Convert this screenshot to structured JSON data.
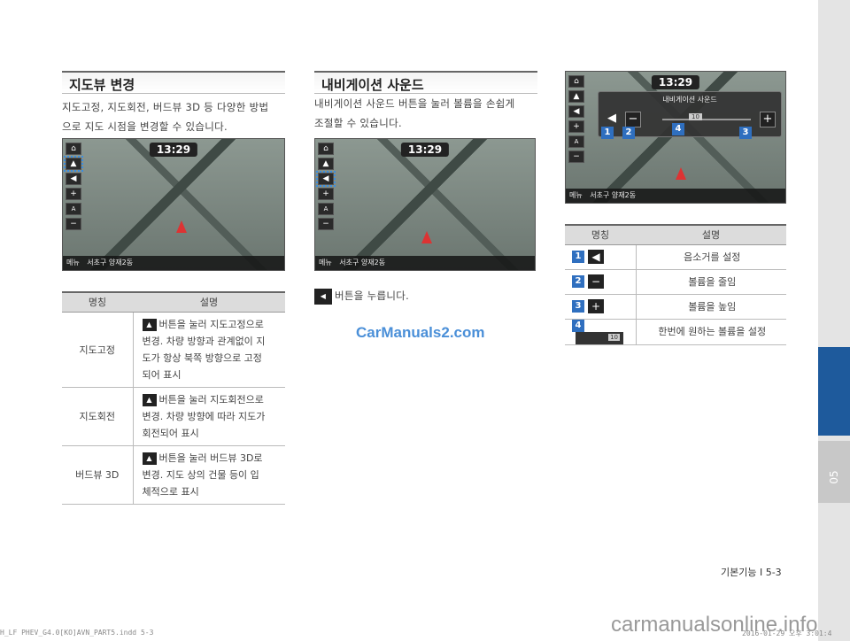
{
  "sidebar": {
    "chapter": "05"
  },
  "sec1": {
    "title": "지도뷰 변경",
    "para_line1": "지도고정, 지도회전, 버드뷰 3D 등 다양한 방법",
    "para_line2": "으로 지도 시점을 변경할 수 있습니다.",
    "screen": {
      "clock": "13:29",
      "menu": "메뉴",
      "location": "서초구 양재2동"
    },
    "table": {
      "col_name": "명칭",
      "col_desc": "설명",
      "rows": [
        {
          "name": "지도고정",
          "l1": "버튼을 눌러 지도고정으로",
          "l2": "변경. 차량 방향과 관계없이 지",
          "l3": "도가 항상 북쪽 방향으로 고정",
          "l4": "되어 표시"
        },
        {
          "name": "지도회전",
          "l1": "버튼을 눌러 지도회전으로",
          "l2": "변경. 차량 방향에 따라 지도가",
          "l3": "회전되어 표시"
        },
        {
          "name": "버드뷰 3D",
          "l1": "버튼을 눌러 버드뷰 3D로",
          "l2": "변경. 지도 상의 건물 등이 입",
          "l3": "체적으로 표시"
        }
      ]
    }
  },
  "sec2": {
    "title": "내비게이션 사운드",
    "para_line1": "내비게이션 사운드 버튼을 눌러 볼륨을 손쉽게",
    "para_line2": "조절할 수 있습니다.",
    "screen": {
      "clock": "13:29",
      "menu": "메뉴",
      "location": "서초구 양재2동"
    },
    "press_text": "버튼을 누릅니다."
  },
  "sec3": {
    "screen": {
      "clock": "13:29",
      "popup_title": "내비게이션 사운드",
      "volume": "10",
      "menu": "메뉴",
      "location": "서초구 양재2동"
    },
    "markers": [
      "1",
      "2",
      "3",
      "4"
    ],
    "table": {
      "col_name": "명칭",
      "col_desc": "설명",
      "rows": [
        {
          "num": "1",
          "desc": "음소거를 설정"
        },
        {
          "num": "2",
          "desc": "볼륨을 줄임"
        },
        {
          "num": "3",
          "desc": "볼륨을 높임"
        },
        {
          "num": "4",
          "desc": "한번에 원하는 볼륨을 설정",
          "slider": "10"
        }
      ]
    }
  },
  "page_number": "기본기능 I 5-3",
  "footer_left": "H_LF PHEV_G4.0[KO]AVN_PART5.indd   5-3",
  "footer_right": "2016-01-29  오후 3:01:4",
  "watermark": "CarManuals2.com",
  "watermark2": "carmanualsonline.info"
}
